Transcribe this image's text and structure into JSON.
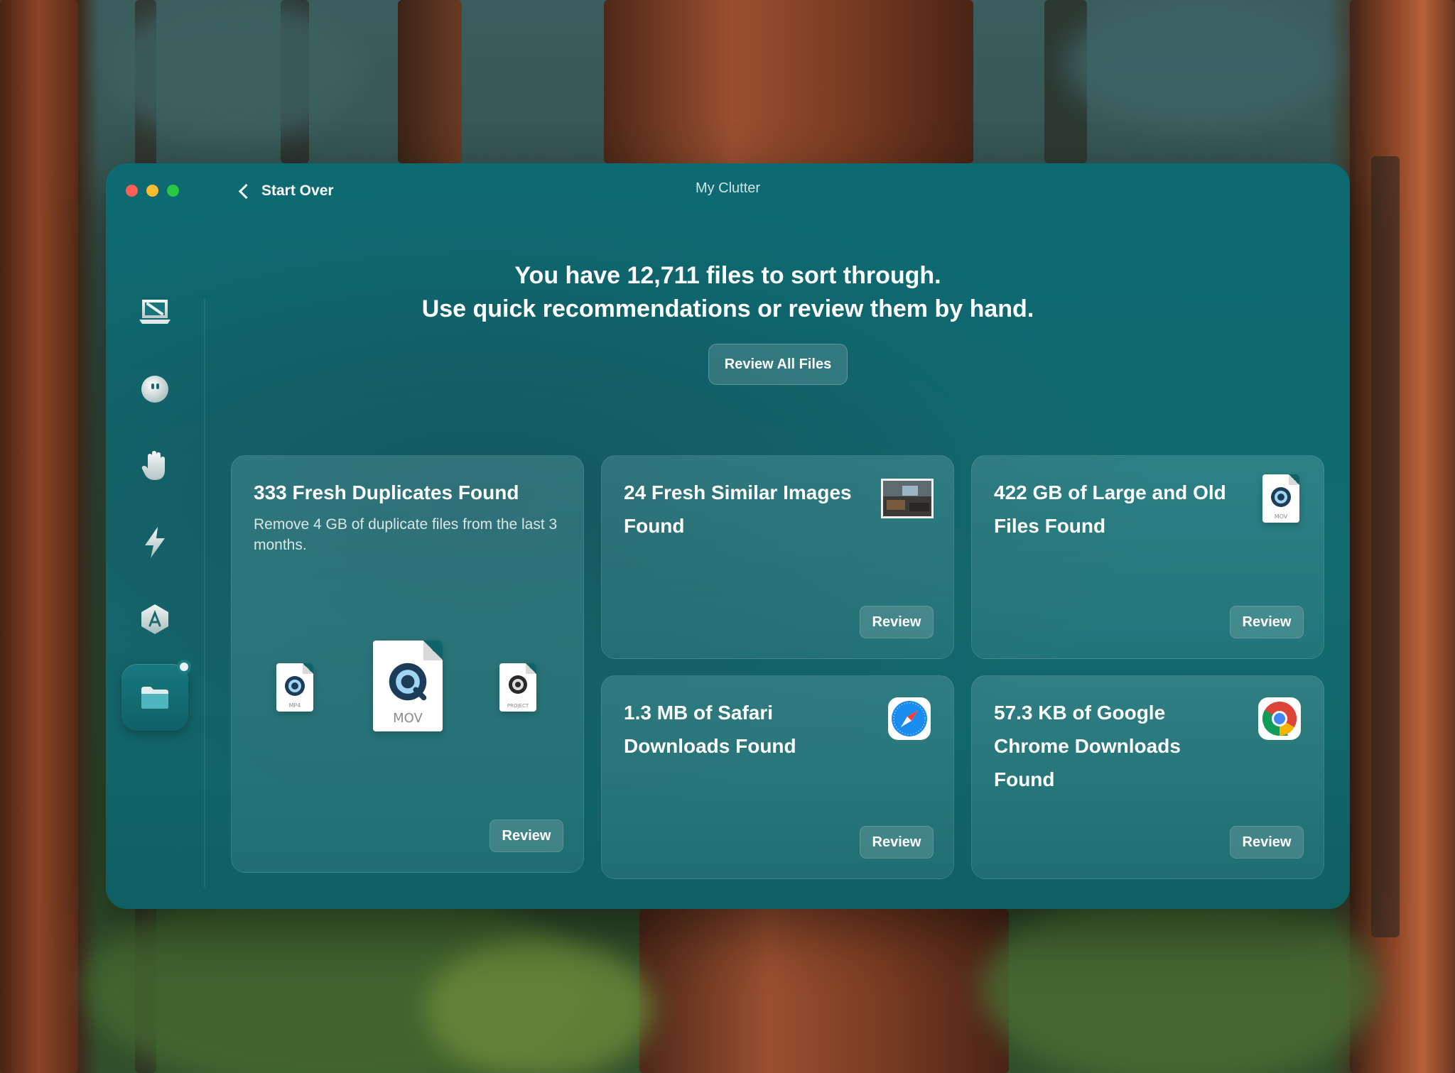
{
  "window": {
    "title": "My Clutter",
    "back_label": "Start Over"
  },
  "headline": {
    "line1": "You have 12,711 files to sort through.",
    "line2": "Use quick recommendations or review them by hand."
  },
  "review_all_label": "Review All Files",
  "sidebar": {
    "items": [
      {
        "icon": "cleanup-icon"
      },
      {
        "icon": "protection-icon"
      },
      {
        "icon": "hand-icon"
      },
      {
        "icon": "speed-icon"
      },
      {
        "icon": "applications-icon"
      },
      {
        "icon": "clutter-folder-icon",
        "active": true
      },
      {
        "icon": "assistant-icon"
      }
    ]
  },
  "cards": {
    "duplicates": {
      "title": "333 Fresh Duplicates Found",
      "description": "Remove 4 GB of duplicate files from the last 3 months.",
      "button": "Review",
      "file_labels": [
        "MP4",
        "MOV",
        "PROJECT"
      ]
    },
    "similar_images": {
      "title_line1": "24 Fresh Similar Images",
      "title_line2": "Found",
      "button": "Review"
    },
    "large_old": {
      "title_line1": "422 GB of Large and Old",
      "title_line2": "Files Found",
      "button": "Review",
      "file_label": "MOV"
    },
    "safari": {
      "title_line1": "1.3 MB of Safari",
      "title_line2": "Downloads Found",
      "button": "Review"
    },
    "chrome": {
      "title_line1": "57.3 KB of Google",
      "title_line2": "Chrome Downloads",
      "title_line3": "Found",
      "button": "Review"
    }
  },
  "colors": {
    "window_teal": "#0f6a70",
    "traffic_red": "#fe5f57",
    "traffic_yellow": "#febc2e",
    "traffic_green": "#28c840"
  }
}
